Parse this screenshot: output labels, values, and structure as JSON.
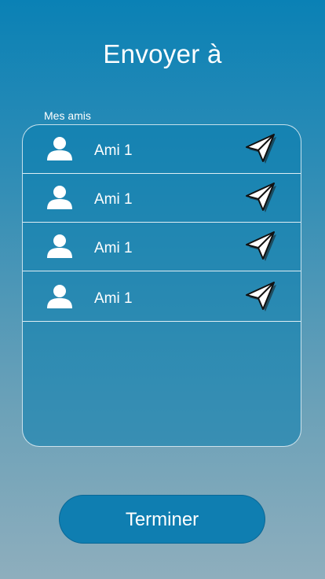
{
  "header": {
    "title": "Envoyer à"
  },
  "friends": {
    "section_label": "Mes amis",
    "items": [
      {
        "name": "Ami 1",
        "avatar_icon": "user-icon",
        "send_icon": "paper-plane-icon"
      },
      {
        "name": "Ami 1",
        "avatar_icon": "user-icon",
        "send_icon": "paper-plane-icon"
      },
      {
        "name": "Ami 1",
        "avatar_icon": "user-icon",
        "send_icon": "paper-plane-icon"
      },
      {
        "name": "Ami 1",
        "avatar_icon": "user-icon",
        "send_icon": "paper-plane-icon"
      }
    ]
  },
  "footer": {
    "done_label": "Terminer"
  },
  "colors": {
    "background_top": "#0a81b5",
    "background_bottom": "#8eaebd",
    "button": "#0f7eb1",
    "text": "#ffffff"
  }
}
